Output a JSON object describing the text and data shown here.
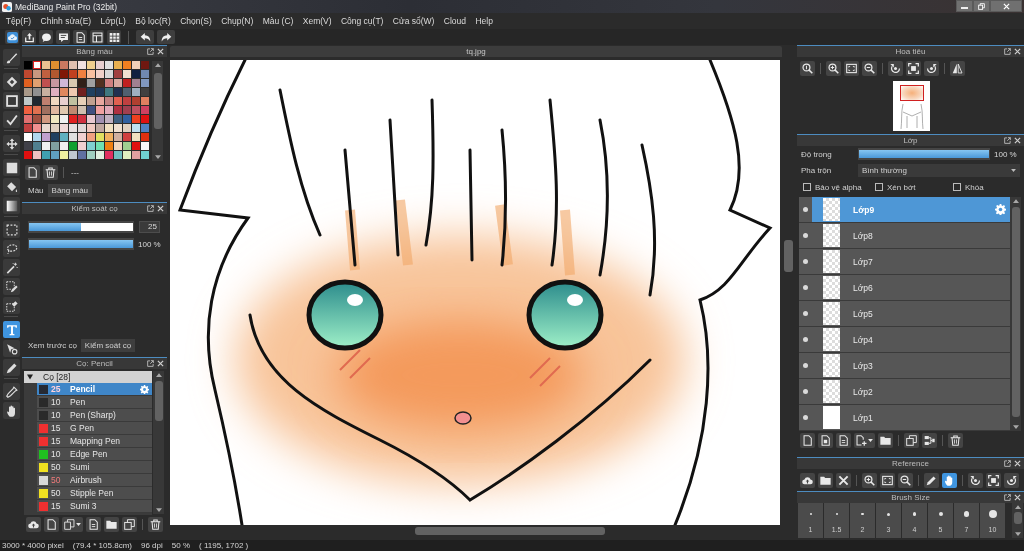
{
  "window": {
    "title": "MediBang Paint Pro (32bit)"
  },
  "menu": [
    "Tệp(F)",
    "Chỉnh sửa(E)",
    "Lớp(L)",
    "Bộ lọc(R)",
    "Chọn(S)",
    "Chụp(N)",
    "Màu (C)",
    "Xem(V)",
    "Công cụ(T)",
    "Cửa sổ(W)",
    "Cloud",
    "Help"
  ],
  "tools": [
    {
      "selected": false
    },
    {
      "selected": false
    },
    {
      "selected": false
    },
    {
      "selected": false
    },
    {
      "selected": false
    },
    {
      "selected": false
    },
    {
      "selected": false
    },
    {
      "selected": false
    },
    {
      "selected": false
    },
    {
      "selected": false
    },
    {
      "selected": false
    },
    {
      "selected": false
    },
    {
      "selected": false
    },
    {
      "selected": true
    },
    {
      "selected": false
    },
    {
      "selected": false
    },
    {
      "selected": false
    },
    {
      "selected": false
    }
  ],
  "palette": {
    "title": "Bảng màu",
    "swatches": [
      {
        "color": "#000000",
        "selected": false
      },
      {
        "color": "#ffffff",
        "selected": true
      },
      {
        "color": "#e8c090",
        "selected": false
      },
      {
        "color": "#e09030",
        "selected": false
      },
      {
        "color": "#c87860",
        "selected": false
      },
      {
        "color": "#e0c0b0",
        "selected": false
      },
      {
        "color": "#f0e0e0",
        "selected": false
      },
      {
        "color": "#f0d090",
        "selected": false
      },
      {
        "color": "#e8d0d0",
        "selected": false
      },
      {
        "color": "#e0e0e0",
        "selected": false
      },
      {
        "color": "#e8b050",
        "selected": false
      },
      {
        "color": "#f08020",
        "selected": false
      },
      {
        "color": "#f0d0b8",
        "selected": false
      },
      {
        "color": "#701810",
        "selected": false
      },
      {
        "color": "#c04830",
        "selected": false
      },
      {
        "color": "#c89880",
        "selected": false
      },
      {
        "color": "#c06040",
        "selected": false
      },
      {
        "color": "#b05830",
        "selected": false
      },
      {
        "color": "#801808",
        "selected": false
      },
      {
        "color": "#c04020",
        "selected": false
      },
      {
        "color": "#f08040",
        "selected": false
      },
      {
        "color": "#f8c0a0",
        "selected": false
      },
      {
        "color": "#f0d0c8",
        "selected": false
      },
      {
        "color": "#d8d8d8",
        "selected": false
      },
      {
        "color": "#a04040",
        "selected": false
      },
      {
        "color": "#f0e0d0",
        "selected": false
      },
      {
        "color": "#102040",
        "selected": false
      },
      {
        "color": "#7088b0",
        "selected": false
      },
      {
        "color": "#e06020",
        "selected": false
      },
      {
        "color": "#e0a070",
        "selected": false
      },
      {
        "color": "#c05050",
        "selected": false
      },
      {
        "color": "#c898a0",
        "selected": false
      },
      {
        "color": "#d0b8d8",
        "selected": false
      },
      {
        "color": "#d8c8b0",
        "selected": false
      },
      {
        "color": "#302018",
        "selected": false
      },
      {
        "color": "#a0a0a0",
        "selected": false
      },
      {
        "color": "#503020",
        "selected": false
      },
      {
        "color": "#d08080",
        "selected": false
      },
      {
        "color": "#d8a8a0",
        "selected": false
      },
      {
        "color": "#c02020",
        "selected": false
      },
      {
        "color": "#a08090",
        "selected": false
      },
      {
        "color": "#8098c0",
        "selected": false
      },
      {
        "color": "#a89888",
        "selected": false
      },
      {
        "color": "#909090",
        "selected": false
      },
      {
        "color": "#c8b0a0",
        "selected": false
      },
      {
        "color": "#e0b0c0",
        "selected": false
      },
      {
        "color": "#e08860",
        "selected": false
      },
      {
        "color": "#f0c8b0",
        "selected": false
      },
      {
        "color": "#702020",
        "selected": false
      },
      {
        "color": "#204060",
        "selected": false
      },
      {
        "color": "#203858",
        "selected": false
      },
      {
        "color": "#407880",
        "selected": false
      },
      {
        "color": "#203050",
        "selected": false
      },
      {
        "color": "#506070",
        "selected": false
      },
      {
        "color": "#a0b0c0",
        "selected": false
      },
      {
        "color": "#404040",
        "selected": false
      },
      {
        "color": "#c0c8c8",
        "selected": false
      },
      {
        "color": "#202830",
        "selected": false
      },
      {
        "color": "#c08070",
        "selected": false
      },
      {
        "color": "#f0d8c0",
        "selected": false
      },
      {
        "color": "#e8d0d0",
        "selected": false
      },
      {
        "color": "#c0c0a0",
        "selected": false
      },
      {
        "color": "#e8d0b8",
        "selected": false
      },
      {
        "color": "#c0a090",
        "selected": false
      },
      {
        "color": "#e8a8a0",
        "selected": false
      },
      {
        "color": "#c08080",
        "selected": false
      },
      {
        "color": "#e06050",
        "selected": false
      },
      {
        "color": "#c04040",
        "selected": false
      },
      {
        "color": "#b04030",
        "selected": false
      },
      {
        "color": "#e08060",
        "selected": false
      },
      {
        "color": "#f06040",
        "selected": false
      },
      {
        "color": "#e07050",
        "selected": false
      },
      {
        "color": "#a07060",
        "selected": false
      },
      {
        "color": "#e0b8a0",
        "selected": false
      },
      {
        "color": "#e0c8b0",
        "selected": false
      },
      {
        "color": "#c08870",
        "selected": false
      },
      {
        "color": "#d0c0b0",
        "selected": false
      },
      {
        "color": "#405080",
        "selected": false
      },
      {
        "color": "#f0a0a0",
        "selected": false
      },
      {
        "color": "#e0a8b8",
        "selected": false
      },
      {
        "color": "#b03040",
        "selected": false
      },
      {
        "color": "#a04050",
        "selected": false
      },
      {
        "color": "#c05060",
        "selected": false
      },
      {
        "color": "#d04060",
        "selected": false
      },
      {
        "color": "#e07070",
        "selected": false
      },
      {
        "color": "#a05040",
        "selected": false
      },
      {
        "color": "#d09880",
        "selected": false
      },
      {
        "color": "#f0e8c0",
        "selected": false
      },
      {
        "color": "#f0f0f0",
        "selected": false
      },
      {
        "color": "#e02020",
        "selected": false
      },
      {
        "color": "#d03040",
        "selected": false
      },
      {
        "color": "#e8c8d0",
        "selected": false
      },
      {
        "color": "#a090b0",
        "selected": false
      },
      {
        "color": "#c0b0c0",
        "selected": false
      },
      {
        "color": "#406080",
        "selected": false
      },
      {
        "color": "#3060a0",
        "selected": false
      },
      {
        "color": "#f04020",
        "selected": false
      },
      {
        "color": "#e01010",
        "selected": false
      },
      {
        "color": "#c04040",
        "selected": false
      },
      {
        "color": "#f09090",
        "selected": false
      },
      {
        "color": "#e8d8d0",
        "selected": false
      },
      {
        "color": "#e0d0c0",
        "selected": false
      },
      {
        "color": "#f0d8d8",
        "selected": false
      },
      {
        "color": "#e8e0e0",
        "selected": false
      },
      {
        "color": "#e0d8d8",
        "selected": false
      },
      {
        "color": "#f0c8c0",
        "selected": false
      },
      {
        "color": "#c0a8a0",
        "selected": false
      },
      {
        "color": "#f0e0c0",
        "selected": false
      },
      {
        "color": "#f0e0d0",
        "selected": false
      },
      {
        "color": "#e0d0c0",
        "selected": false
      },
      {
        "color": "#c0e0f0",
        "selected": false
      },
      {
        "color": "#5080c0",
        "selected": false
      },
      {
        "color": "#ffffff",
        "selected": false
      },
      {
        "color": "#b0d8f0",
        "selected": false
      },
      {
        "color": "#c0a0d0",
        "selected": false
      },
      {
        "color": "#204060",
        "selected": false
      },
      {
        "color": "#60b0c0",
        "selected": false
      },
      {
        "color": "#e0e0e0",
        "selected": false
      },
      {
        "color": "#f0d0d0",
        "selected": false
      },
      {
        "color": "#f0a080",
        "selected": false
      },
      {
        "color": "#e0e060",
        "selected": false
      },
      {
        "color": "#f0b060",
        "selected": false
      },
      {
        "color": "#d0b0a0",
        "selected": false
      },
      {
        "color": "#d04040",
        "selected": false
      },
      {
        "color": "#f0e0c0",
        "selected": false
      },
      {
        "color": "#e03010",
        "selected": false
      },
      {
        "color": "#404048",
        "selected": false
      },
      {
        "color": "#508090",
        "selected": false
      },
      {
        "color": "#f0f0f0",
        "selected": false
      },
      {
        "color": "#80a0a0",
        "selected": false
      },
      {
        "color": "#f0f0f0",
        "selected": false
      },
      {
        "color": "#10a030",
        "selected": false
      },
      {
        "color": "#f0d0d0",
        "selected": false
      },
      {
        "color": "#80d0d0",
        "selected": false
      },
      {
        "color": "#70e0b0",
        "selected": false
      },
      {
        "color": "#f08010",
        "selected": false
      },
      {
        "color": "#f0d8c0",
        "selected": false
      },
      {
        "color": "#a0d090",
        "selected": false
      },
      {
        "color": "#e01010",
        "selected": false
      },
      {
        "color": "#f8f8f8",
        "selected": false
      },
      {
        "color": "#e01010",
        "selected": false
      },
      {
        "color": "#f0c0c0",
        "selected": false
      },
      {
        "color": "#40a0b0",
        "selected": false
      },
      {
        "color": "#60a0c0",
        "selected": false
      },
      {
        "color": "#f0f0a0",
        "selected": false
      },
      {
        "color": "#c0c8d0",
        "selected": false
      },
      {
        "color": "#6070a0",
        "selected": false
      },
      {
        "color": "#a0d0c0",
        "selected": false
      },
      {
        "color": "#e0f0e0",
        "selected": false
      },
      {
        "color": "#e03060",
        "selected": false
      },
      {
        "color": "#70c0c0",
        "selected": false
      },
      {
        "color": "#e0f0c0",
        "selected": false
      },
      {
        "color": "#e0a0a0",
        "selected": false
      },
      {
        "color": "#70d0d0",
        "selected": false
      }
    ],
    "footer": "---",
    "tabs": [
      {
        "label": "Màu",
        "selected": false
      },
      {
        "label": "Bảng màu",
        "selected": true
      }
    ]
  },
  "brush_control": {
    "title": "Kiểm soát cọ",
    "sliders": [
      {
        "kind": "size",
        "level": 0.5,
        "reading": "25"
      },
      {
        "kind": "opacity",
        "level": 1,
        "reading": "100 %"
      }
    ],
    "tabs": [
      {
        "label": "Xem trước cọ",
        "selected": false
      },
      {
        "label": "Kiểm soát cọ",
        "selected": true
      }
    ]
  },
  "brushes": {
    "title": "Cọ: Pencil",
    "folder": {
      "label": "Cọ [28]",
      "expanded": true,
      "children": [
        {
          "name": "Pencil",
          "size": "25",
          "color": "#262a33",
          "size_highlight": true,
          "selected": true
        },
        {
          "name": "Pen",
          "size": "10",
          "color": "#2a2a2a",
          "size_highlight": false,
          "selected": false
        },
        {
          "name": "Pen (Sharp)",
          "size": "10",
          "color": "#2a2a2a",
          "size_highlight": false,
          "selected": false
        },
        {
          "name": "G Pen",
          "size": "15",
          "color": "#f03030",
          "size_highlight": false,
          "selected": false
        },
        {
          "name": "Mapping Pen",
          "size": "15",
          "color": "#f03030",
          "size_highlight": false,
          "selected": false
        },
        {
          "name": "Edge Pen",
          "size": "10",
          "color": "#20c020",
          "size_highlight": false,
          "selected": false
        },
        {
          "name": "Sumi",
          "size": "50",
          "color": "#f0e020",
          "size_highlight": false,
          "selected": false
        },
        {
          "name": "Airbrush",
          "size": "50",
          "color": "#d8d8d8",
          "size_highlight": true,
          "selected": false
        },
        {
          "name": "Stipple Pen",
          "size": "50",
          "color": "#f0e020",
          "size_highlight": false,
          "selected": false
        },
        {
          "name": "Sumi 3",
          "size": "15",
          "color": "#f03030",
          "size_highlight": false,
          "selected": false
        }
      ]
    }
  },
  "document": {
    "tab": "tq.jpg"
  },
  "navigator": {
    "title": "Hoa tiêu"
  },
  "layers": {
    "title": "Lớp",
    "opacity": {
      "label": "Độ trong",
      "level": 1,
      "reading": "100 %"
    },
    "blend": {
      "label": "Pha trộn",
      "value": "Bình thường"
    },
    "options": [
      {
        "label": "Bảo vệ alpha",
        "checked": false
      },
      {
        "label": "Xén bớt",
        "checked": false
      },
      {
        "label": "Khóa",
        "checked": false
      }
    ],
    "items": [
      {
        "name": "Lớp9",
        "selected": true,
        "visible": true,
        "opaque": false
      },
      {
        "name": "Lớp8",
        "selected": false,
        "visible": true,
        "opaque": false
      },
      {
        "name": "Lớp7",
        "selected": false,
        "visible": true,
        "opaque": false
      },
      {
        "name": "Lớp6",
        "selected": false,
        "visible": true,
        "opaque": false
      },
      {
        "name": "Lớp5",
        "selected": false,
        "visible": true,
        "opaque": false
      },
      {
        "name": "Lớp4",
        "selected": false,
        "visible": true,
        "opaque": false
      },
      {
        "name": "Lớp3",
        "selected": false,
        "visible": true,
        "opaque": false
      },
      {
        "name": "Lớp2",
        "selected": false,
        "visible": true,
        "opaque": false
      },
      {
        "name": "Lớp1",
        "selected": false,
        "visible": true,
        "opaque": true
      }
    ]
  },
  "reference": {
    "title": "Reference",
    "tools": [
      {
        "selected": false
      },
      {
        "selected": false
      },
      {
        "selected": false
      },
      {
        "selected": false
      },
      {
        "selected": false
      },
      {
        "selected": false
      },
      {
        "selected": false
      },
      {
        "selected": true
      },
      {
        "selected": false
      },
      {
        "selected": false
      },
      {
        "selected": false
      }
    ]
  },
  "brush_size": {
    "title": "Brush Size",
    "sizes": [
      "1",
      "1.5",
      "2",
      "3",
      "4",
      "5",
      "7",
      "10"
    ]
  },
  "status_bar": [
    "3000 * 4000 pixel",
    "(79.4 * 105.8cm)",
    "96 dpi",
    "50 %",
    "( 1195, 1702 )"
  ]
}
